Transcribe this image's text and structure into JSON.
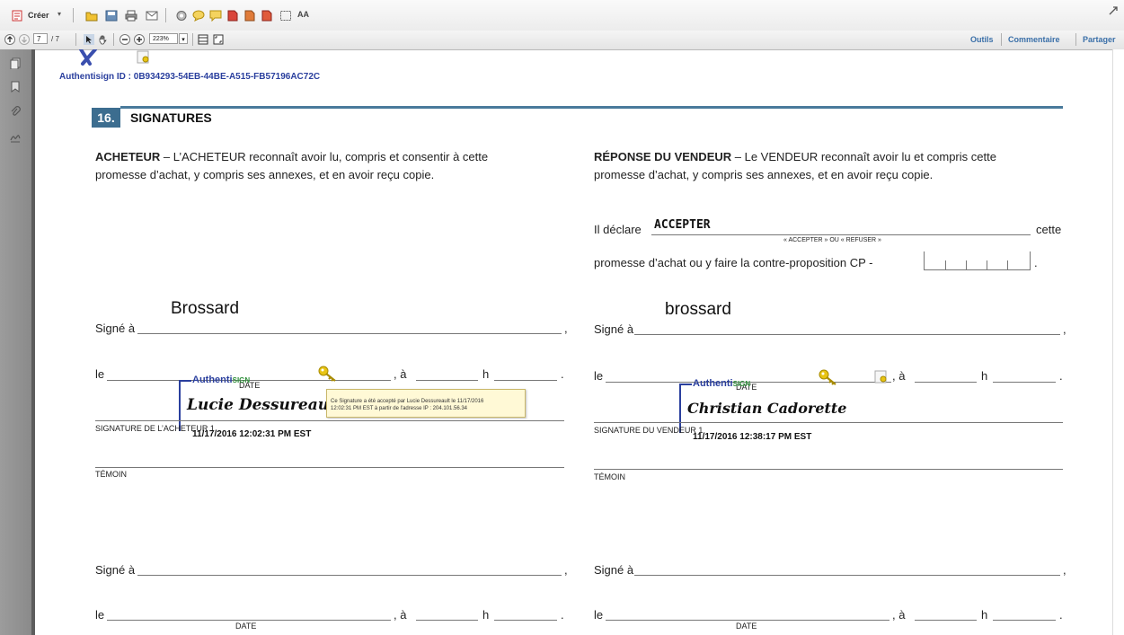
{
  "toolbar": {
    "create_label": "Créer",
    "icons": [
      "create-icon",
      "open-icon",
      "save-icon",
      "print-icon",
      "email-icon",
      "settings-icon",
      "comment-icon",
      "comment2-icon",
      "pdf-icon",
      "pdf2-icon",
      "pdf3-icon",
      "select-icon",
      "text-size-icon"
    ]
  },
  "navbar": {
    "page_current": "7",
    "page_total": "/ 7",
    "zoom": "223%",
    "links": {
      "tools": "Outils",
      "comment": "Commentaire",
      "share": "Partager"
    }
  },
  "doc": {
    "authentisign_id": "Authentisign ID : 0B934293-54EB-44BE-A515-FB57196AC72C",
    "section_number": "16.",
    "section_title": "SIGNATURES",
    "buyer": {
      "heading": "ACHETEUR",
      "text_line1": " – L’ACHETEUR reconnaît avoir lu, compris et consentir à cette",
      "text_line2": "promesse d’achat, y compris ses annexes, et en avoir reçu copie."
    },
    "seller": {
      "heading": "RÉPONSE DU VENDEUR",
      "text_line1": " – Le VENDEUR reconnaît avoir lu et compris cette",
      "text_line2": "promesse d’achat, y compris ses annexes, et en avoir reçu copie.",
      "declare_label": "Il déclare",
      "declare_value": "ACCEPTER",
      "declare_suffix": "cette",
      "declare_hint": "« ACCEPTER » OU « REFUSER »",
      "counter_text": "promesse d’achat ou y faire la contre-proposition CP -"
    },
    "signed_at": "Signé à",
    "le": "le",
    "a": ", à",
    "h": "h",
    "comma": ",",
    "period": ".",
    "date": "DATE",
    "buyer_city": "Brossard",
    "seller_city": "brossard",
    "buyer_sig_label": "SIGNATURE DE L’ACHETEUR 1",
    "seller_sig_label": "SIGNATURE DU VENDEUR 1",
    "witness": "TÉMOIN",
    "buyer_signature": {
      "auth_blue": "Authenti",
      "auth_green": "SIGN",
      "name": "Lucie Dessureault",
      "timestamp": "11/17/2016 12:02:31 PM EST"
    },
    "seller_signature": {
      "auth_blue": "Authenti",
      "auth_green": "SIGN",
      "name": "Christian Cadorette",
      "timestamp": "11/17/2016 12:38:17 PM EST"
    },
    "tooltip": {
      "line1": "Ce Signature a été accepté par Lucie Dessureault le 11/17/2016",
      "line2": "12:02:31 PM EST à partir de l'adresse IP : 204.101.56.34"
    }
  },
  "colors": {
    "section_badge": "#3c6d8f",
    "section_rule": "#4a7a9b",
    "auth_id": "#2a3f9e",
    "key": "#e8c414"
  }
}
